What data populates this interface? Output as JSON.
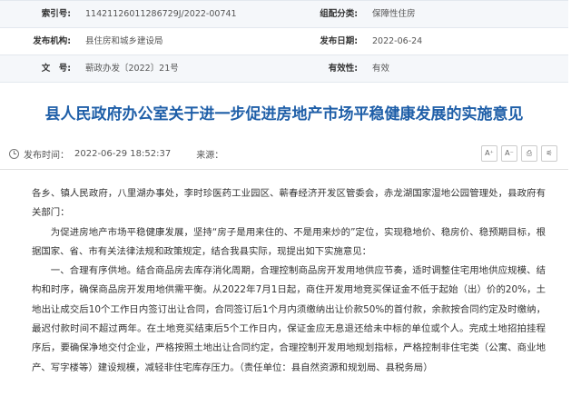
{
  "meta": {
    "rows": [
      {
        "label_left": "索引号:",
        "value_left": "11421126011286729J/2022-00741",
        "label_right": "组配分类:",
        "value_right": "保障性住房"
      },
      {
        "label_left": "发布机构:",
        "value_left": "县住房和城乡建设局",
        "label_right": "发布日期:",
        "value_right": "2022-06-24"
      },
      {
        "label_left": "文　号:",
        "value_left": "蕲政办发〔2022〕21号",
        "label_right": "有效性:",
        "value_right": "有效"
      }
    ]
  },
  "title": "县人民政府办公室关于进一步促进房地产市场平稳健康发展的实施意见",
  "info": {
    "publish_label": "发布时间：",
    "publish_time": "2022-06-29 18:52:37",
    "source_label": "来源：",
    "tools": [
      "A⁺",
      "A⁻",
      "⎙",
      "⚟"
    ]
  },
  "body": {
    "addressee": "各乡、镇人民政府，八里湖办事处，李时珍医药工业园区、蕲春经济开发区管委会，赤龙湖国家湿地公园管理处，县政府有关部门：",
    "para1": "为促进房地产市场平稳健康发展，坚持“房子是用来住的、不是用来炒的”定位，实现稳地价、稳房价、稳预期目标，根据国家、省、市有关法律法规和政策规定，结合我县实际，现提出如下实施意见：",
    "para2": "一、合理有序供地。结合商品房去库存消化周期，合理控制商品房开发用地供应节奏，适时调整住宅用地供应规模、结构和时序，确保商品房开发用地供需平衡。从2022年7月1日起，商住开发用地竞买保证金不低于起始（出）价的20%，土地出让成交后10个工作日内签订出让合同，合同签订后1个月内须缴纳出让价款50%的首付款，余款按合同约定及时缴纳，最迟付款时间不超过两年。在土地竞买结束后5个工作日内，保证金应无息退还给未中标的单位或个人。完成土地招拍挂程序后，要确保净地交付企业，严格按照土地出让合同约定，合理控制开发用地规划指标，严格控制非住宅类（公寓、商业地产、写字楼等）建设规模，减轻非住宅库存压力。（责任单位：县自然资源和规划局、县税务局）"
  }
}
